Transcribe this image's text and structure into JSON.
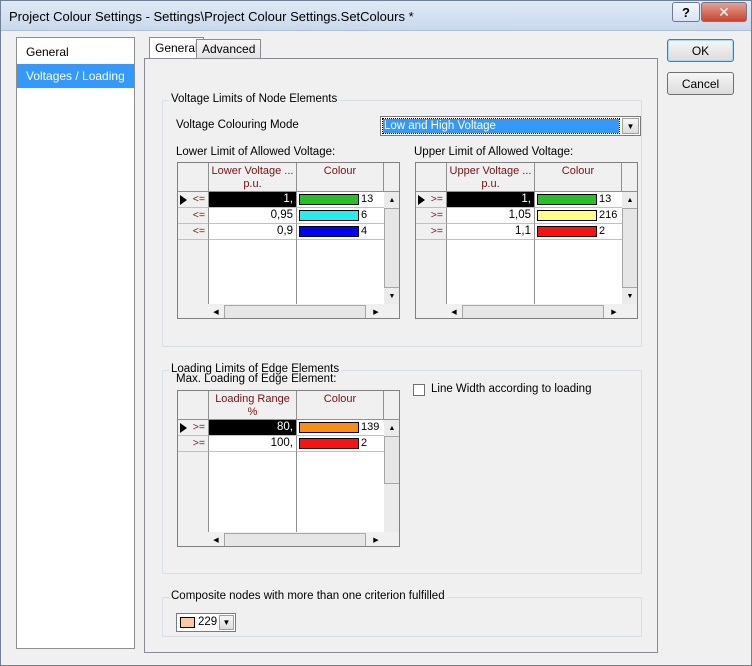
{
  "window": {
    "title": "Project Colour Settings - Settings\\Project Colour Settings.SetColours *",
    "help_label": "?",
    "close_label": "✕"
  },
  "nav": {
    "items": [
      {
        "label": "General",
        "selected": false
      },
      {
        "label": "Voltages / Loading",
        "selected": true
      }
    ]
  },
  "tabs": [
    {
      "label": "General",
      "active": true
    },
    {
      "label": "Advanced",
      "active": false
    }
  ],
  "buttons": {
    "ok": "OK",
    "cancel": "Cancel"
  },
  "voltage_group": {
    "legend": "Voltage Limits of Node Elements",
    "mode_label": "Voltage Colouring Mode",
    "mode_value": "Low and High Voltage",
    "lower": {
      "label": "Lower Limit of Allowed Voltage:",
      "col_value": "Lower Voltage ...",
      "col_unit": "p.u.",
      "col_colour": "Colour",
      "rows": [
        {
          "op": "<=",
          "value": "1,",
          "color": "#22c322",
          "index": "13",
          "selected": true
        },
        {
          "op": "<=",
          "value": "0,95",
          "color": "#22f0f0",
          "index": "6",
          "selected": false
        },
        {
          "op": "<=",
          "value": "0,9",
          "color": "#0000ff",
          "index": "4",
          "selected": false
        }
      ]
    },
    "upper": {
      "label": "Upper Limit of Allowed Voltage:",
      "col_value": "Upper Voltage ...",
      "col_unit": "p.u.",
      "col_colour": "Colour",
      "rows": [
        {
          "op": ">=",
          "value": "1,",
          "color": "#22c322",
          "index": "13",
          "selected": true
        },
        {
          "op": ">=",
          "value": "1,05",
          "color": "#ffff80",
          "index": "216",
          "selected": false
        },
        {
          "op": ">=",
          "value": "1,1",
          "color": "#ff1010",
          "index": "2",
          "selected": false
        }
      ]
    }
  },
  "loading_group": {
    "legend": "Loading Limits of Edge Elements",
    "max_label": "Max. Loading of Edge Element:",
    "checkbox_label": "Line Width according to loading",
    "checkbox_checked": false,
    "grid": {
      "col_value": "Loading Range",
      "col_unit": "%",
      "col_colour": "Colour",
      "rows": [
        {
          "op": ">=",
          "value": "80,",
          "color": "#ff8c10",
          "index": "139",
          "selected": true
        },
        {
          "op": ">=",
          "value": "100,",
          "color": "#ff1010",
          "index": "2",
          "selected": false
        }
      ]
    }
  },
  "composite_group": {
    "legend": "Composite nodes with more than one criterion fulfilled",
    "color": "#ffc8a0",
    "index": "229"
  }
}
